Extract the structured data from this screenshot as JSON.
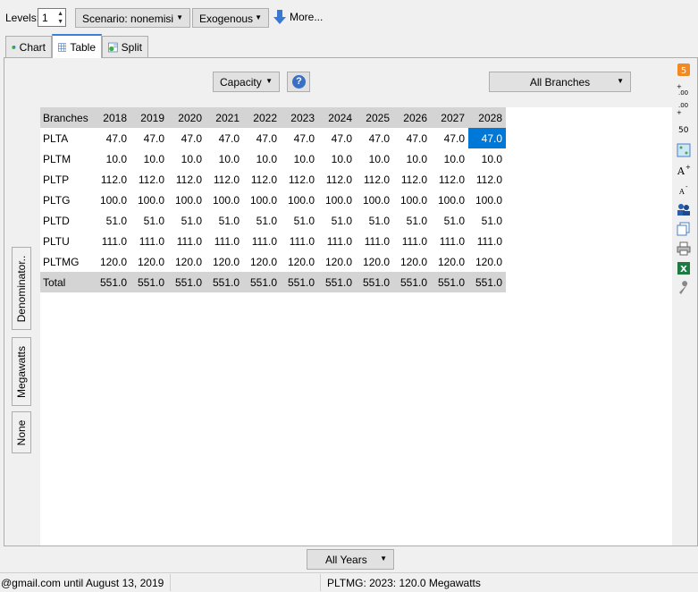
{
  "toolbar": {
    "levels_label": "Levels:",
    "levels_value": "1",
    "scenario": "Scenario: nonemisi",
    "exogenous": "Exogenous",
    "more": "More..."
  },
  "tabs": [
    {
      "label": "Chart",
      "icon": "chart-icon"
    },
    {
      "label": "Table",
      "icon": "table-icon"
    },
    {
      "label": "Split",
      "icon": "split-icon"
    }
  ],
  "controls": {
    "measure": "Capacity",
    "branches_filter": "All Branches",
    "years_filter": "All Years"
  },
  "side_tabs": [
    "Denominator..",
    "Megawatts",
    "None"
  ],
  "table": {
    "header_first": "Branches",
    "years": [
      "2018",
      "2019",
      "2020",
      "2021",
      "2022",
      "2023",
      "2024",
      "2025",
      "2026",
      "2027",
      "2028"
    ],
    "rows": [
      {
        "name": "PLTA",
        "values": [
          "47.0",
          "47.0",
          "47.0",
          "47.0",
          "47.0",
          "47.0",
          "47.0",
          "47.0",
          "47.0",
          "47.0",
          "47.0"
        ]
      },
      {
        "name": "PLTM",
        "values": [
          "10.0",
          "10.0",
          "10.0",
          "10.0",
          "10.0",
          "10.0",
          "10.0",
          "10.0",
          "10.0",
          "10.0",
          "10.0"
        ]
      },
      {
        "name": "PLTP",
        "values": [
          "112.0",
          "112.0",
          "112.0",
          "112.0",
          "112.0",
          "112.0",
          "112.0",
          "112.0",
          "112.0",
          "112.0",
          "112.0"
        ]
      },
      {
        "name": "PLTG",
        "values": [
          "100.0",
          "100.0",
          "100.0",
          "100.0",
          "100.0",
          "100.0",
          "100.0",
          "100.0",
          "100.0",
          "100.0",
          "100.0"
        ]
      },
      {
        "name": "PLTD",
        "values": [
          "51.0",
          "51.0",
          "51.0",
          "51.0",
          "51.0",
          "51.0",
          "51.0",
          "51.0",
          "51.0",
          "51.0",
          "51.0"
        ]
      },
      {
        "name": "PLTU",
        "values": [
          "111.0",
          "111.0",
          "111.0",
          "111.0",
          "111.0",
          "111.0",
          "111.0",
          "111.0",
          "111.0",
          "111.0",
          "111.0"
        ]
      },
      {
        "name": "PLTMG",
        "values": [
          "120.0",
          "120.0",
          "120.0",
          "120.0",
          "120.0",
          "120.0",
          "120.0",
          "120.0",
          "120.0",
          "120.0",
          "120.0"
        ]
      }
    ],
    "total": {
      "name": "Total",
      "values": [
        "551.0",
        "551.0",
        "551.0",
        "551.0",
        "551.0",
        "551.0",
        "551.0",
        "551.0",
        "551.0",
        "551.0",
        "551.0"
      ]
    },
    "selected_cell": {
      "row": 0,
      "col": 10
    }
  },
  "status": {
    "license": "@gmail.com until August 13, 2019",
    "cell_info": "PLTMG: 2023: 120.0 Megawatts"
  },
  "right_tools": [
    "sheet-icon",
    "decimals-increase-icon",
    "decimals-decrease-icon",
    "zero-icon",
    "grid-icon",
    "font-increase-icon",
    "font-decrease-icon",
    "users-icon",
    "copy-icon",
    "print-icon",
    "excel-icon",
    "settings-wrench-icon"
  ],
  "colors": {
    "selection": "#0078d7",
    "header": "#d4d4d4",
    "accent": "#3c7fd8"
  }
}
